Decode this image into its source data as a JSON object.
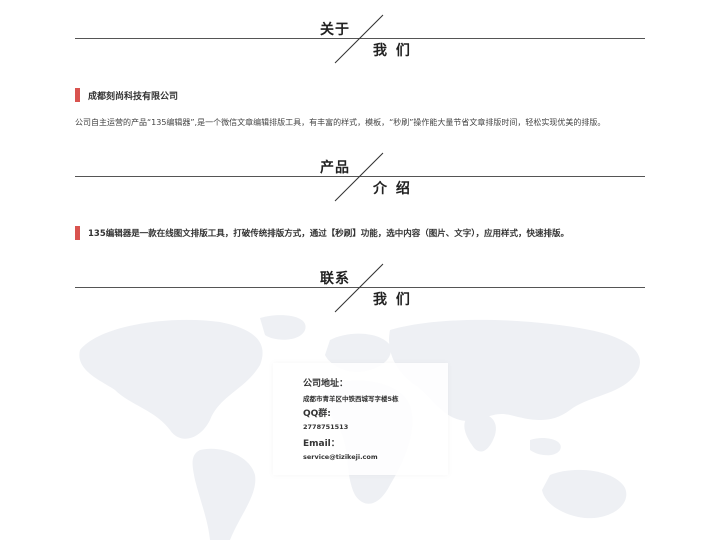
{
  "sections": {
    "about": {
      "top": "关于",
      "bottom": "我 们"
    },
    "product": {
      "top": "产品",
      "bottom": "介 绍"
    },
    "contact": {
      "top": "联系",
      "bottom": "我 们"
    }
  },
  "about": {
    "company_name": "成都刻尚科技有限公司",
    "description": "公司自主运营的产品“135编辑器”,是一个微信文章编辑排版工具，有丰富的样式，模板，“秒刷”操作能大量节省文章排版时间，轻松实现优美的排版。"
  },
  "product": {
    "description": "135编辑器是一款在线图文排版工具，打破传统排版方式，通过【秒刷】功能，选中内容（图片、文字），应用样式，快速排版。"
  },
  "contact": {
    "address_label": "公司地址：",
    "address_value": "成都市青羊区中铁西城写字楼5栋",
    "qq_label": "QQ群:",
    "qq_value": "2778751513",
    "email_label": "Email：",
    "email_value": "service@tizikeji.com"
  },
  "colors": {
    "accent": "#d9534f",
    "map": "#eef0f4"
  },
  "icons": {
    "background": "world-map-icon"
  }
}
